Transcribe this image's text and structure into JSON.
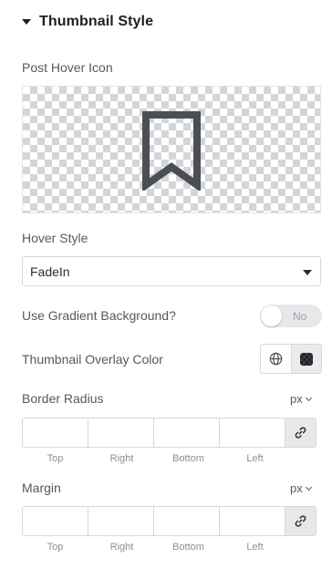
{
  "section": {
    "title": "Thumbnail Style"
  },
  "post_hover_icon": {
    "label": "Post Hover Icon",
    "icon": "bookmark-icon"
  },
  "hover_style": {
    "label": "Hover Style",
    "value": "FadeIn"
  },
  "gradient_background": {
    "label": "Use Gradient Background?",
    "toggle_text": "No",
    "enabled": false
  },
  "overlay_color": {
    "label": "Thumbnail Overlay Color",
    "global_icon": "globe-icon",
    "swatch": "#3a3c40"
  },
  "border_radius": {
    "label": "Border Radius",
    "unit": "px",
    "fields": [
      {
        "label": "Top",
        "value": ""
      },
      {
        "label": "Right",
        "value": ""
      },
      {
        "label": "Bottom",
        "value": ""
      },
      {
        "label": "Left",
        "value": ""
      }
    ]
  },
  "margin": {
    "label": "Margin",
    "unit": "px",
    "fields": [
      {
        "label": "Top",
        "value": ""
      },
      {
        "label": "Right",
        "value": ""
      },
      {
        "label": "Bottom",
        "value": ""
      },
      {
        "label": "Left",
        "value": ""
      }
    ]
  },
  "colors": {
    "text": "#55585d",
    "heading": "#1e1f22",
    "border": "#d5d8dc",
    "icon": "#4b4f55"
  }
}
